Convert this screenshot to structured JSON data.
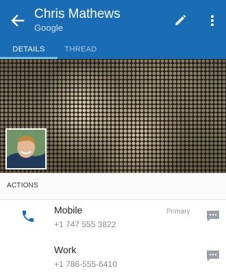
{
  "header": {
    "title": "Chris Mathews",
    "subtitle": "Google",
    "colors": {
      "bar": "#1a6cb5",
      "accent": "#7ec3f0"
    }
  },
  "tabs": [
    {
      "label": "DETAILS",
      "selected": true
    },
    {
      "label": "THREAD",
      "selected": false
    }
  ],
  "section": {
    "label": "ACTIONS"
  },
  "phones": [
    {
      "label": "Mobile",
      "number": "+1 747 555 3822",
      "badge": "Primary"
    },
    {
      "label": "Work",
      "number": "+1 786-555-6410",
      "badge": ""
    }
  ],
  "icons": {
    "back": "back-arrow-icon",
    "edit": "pencil-icon",
    "more": "more-vertical-icon",
    "phone": "phone-icon",
    "message": "message-icon"
  }
}
